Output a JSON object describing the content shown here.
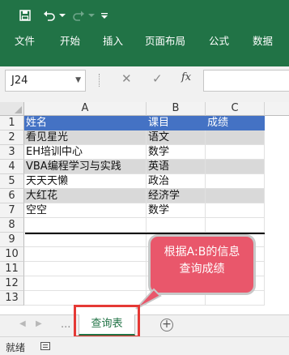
{
  "quick_access": {
    "save_icon": "save-icon",
    "undo_icon": "undo-icon",
    "redo_icon": "redo-icon",
    "customize_icon": "customize-icon"
  },
  "ribbon": {
    "tabs": [
      "文件",
      "开始",
      "插入",
      "页面布局",
      "公式",
      "数据"
    ]
  },
  "formula_bar": {
    "name_box": "J24",
    "cancel_glyph": "✕",
    "enter_glyph": "✓",
    "fx_label": "fx",
    "formula": ""
  },
  "grid": {
    "columns": [
      "A",
      "B",
      "C"
    ],
    "rows": [
      "1",
      "2",
      "3",
      "4",
      "5",
      "6",
      "7",
      "8",
      "9",
      "10",
      "11",
      "12",
      "13"
    ],
    "table": {
      "headers": [
        "姓名",
        "课目",
        "成绩"
      ],
      "data": [
        [
          "看见星光",
          "语文",
          ""
        ],
        [
          "EH培训中心",
          "数学",
          ""
        ],
        [
          "VBA编程学习与实践",
          "英语",
          ""
        ],
        [
          "天天天懒",
          "政治",
          ""
        ],
        [
          "大红花",
          "经济学",
          ""
        ],
        [
          "空空",
          "数学",
          ""
        ]
      ]
    }
  },
  "callout": {
    "line1": "根据A:B的信息",
    "line2": "查询成绩"
  },
  "sheets": {
    "active_tab": "查询表",
    "nav_dots": "...",
    "add_glyph": "+"
  },
  "status": {
    "ready": "就绪"
  },
  "colors": {
    "excel_green": "#217346",
    "header_blue": "#4472c4",
    "band_gray": "#d9d9d9",
    "callout_fill": "#e9576b",
    "highlight_red": "#e53935"
  }
}
